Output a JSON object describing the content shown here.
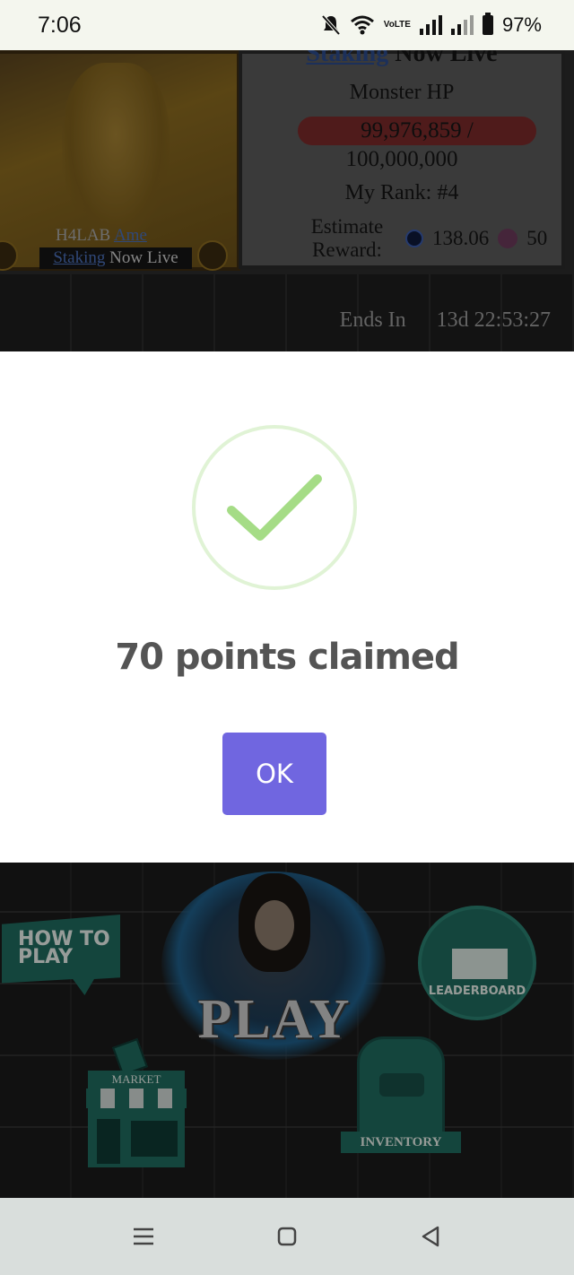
{
  "status": {
    "time": "7:06",
    "lte": "VoLTE",
    "battery": "97%",
    "icons": [
      "bell-off-icon",
      "wifi-icon",
      "volte-icon",
      "signal-icon",
      "signal-icon",
      "battery-icon"
    ]
  },
  "game": {
    "poster": {
      "title_prefix": "H4LAB ",
      "title_link": "Ame",
      "sub_link": "Staking",
      "sub_rest": " Now Live"
    },
    "panel": {
      "heading_link": "Staking",
      "heading_rest": " Now Live",
      "hp_label": "Monster HP",
      "hp_current": "99,976,859 /",
      "hp_total": "100,000,000",
      "rank": "My Rank: #4",
      "reward_label": "Estimate Reward:",
      "reward_value_1": "138.06",
      "reward_value_2": "50"
    },
    "ends_label": "Ends In",
    "ends_value": "13d 22:53:27",
    "menu": {
      "how_to_play": "HOW TO PLAY",
      "play": "PLAY",
      "leaderboard": "LEADERBOARD",
      "market": "MARKET",
      "inventory": "INVENTORY"
    }
  },
  "dialog": {
    "title": "70 points claimed",
    "ok_label": "OK",
    "accent": "#7066e0",
    "check_color": "#a5dc86"
  }
}
